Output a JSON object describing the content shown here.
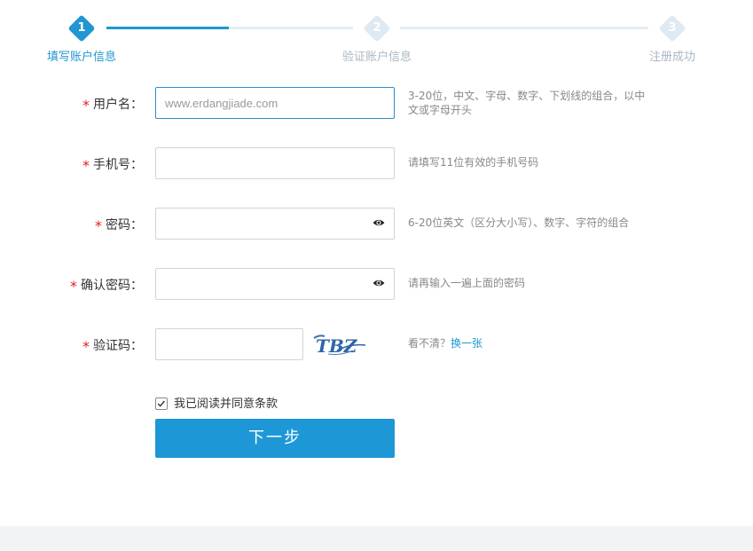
{
  "steps": [
    {
      "num": "1",
      "label": "填写账户信息",
      "state": "active"
    },
    {
      "num": "2",
      "label": "验证账户信息",
      "state": "inactive"
    },
    {
      "num": "3",
      "label": "注册成功",
      "state": "inactive"
    }
  ],
  "form": {
    "username": {
      "required_mark": "*",
      "label": "用户名：",
      "placeholder": "www.erdangjiade.com",
      "value": "",
      "hint": "3-20位，中文、字母、数字、下划线的组合，以中文或字母开头"
    },
    "phone": {
      "required_mark": "*",
      "label": "手机号：",
      "value": "",
      "hint": "请填写11位有效的手机号码"
    },
    "password": {
      "required_mark": "*",
      "label": "密码：",
      "value": "",
      "toggle_icon": "eye-icon",
      "hint": "6-20位英文（区分大小写）、数字、字符的组合"
    },
    "confirm_password": {
      "required_mark": "*",
      "label": "确认密码：",
      "value": "",
      "toggle_icon": "eye-icon",
      "hint": "请再输入一遍上面的密码"
    },
    "captcha": {
      "required_mark": "*",
      "label": "验证码：",
      "value": "",
      "image_text": "TBZ",
      "hint_prefix": "看不清？",
      "hint_link": "换一张"
    }
  },
  "agreement": {
    "checked": true,
    "label": "我已阅读并同意条款"
  },
  "submit_label": "下一步",
  "colors": {
    "accent": "#1e97d7",
    "required": "#e02020",
    "step_inactive": "#dfe9f2"
  }
}
